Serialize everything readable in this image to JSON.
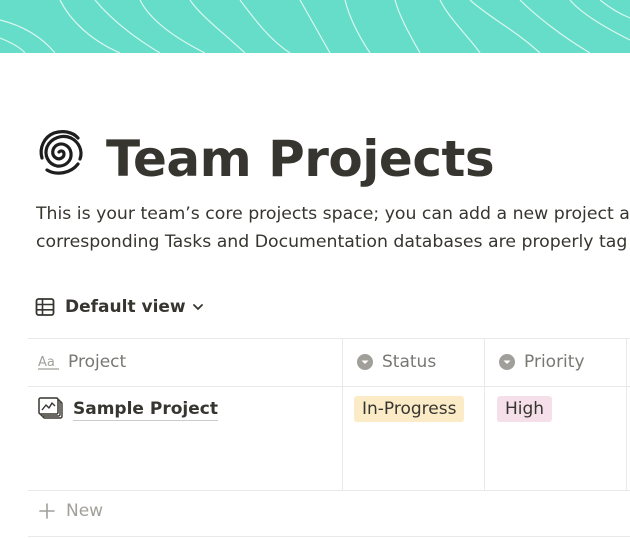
{
  "page": {
    "title": "Team Projects",
    "description_lines": [
      "This is your team’s core projects space; you can add a new project a",
      "corresponding Tasks and Documentation databases are properly tag"
    ],
    "cover_color": "#66ddc8",
    "icon": "spiral-icon"
  },
  "view": {
    "label": "Default view",
    "icon": "table-icon"
  },
  "table": {
    "columns": [
      {
        "label": "Project",
        "icon": "title-property-icon"
      },
      {
        "label": "Status",
        "icon": "select-property-icon"
      },
      {
        "label": "Priority",
        "icon": "select-property-icon"
      }
    ],
    "rows": [
      {
        "project": "Sample Project",
        "status": "In-Progress",
        "status_color": "#fbecc7",
        "priority": "High",
        "priority_color": "#f5e0e9"
      }
    ],
    "new_label": "New"
  }
}
